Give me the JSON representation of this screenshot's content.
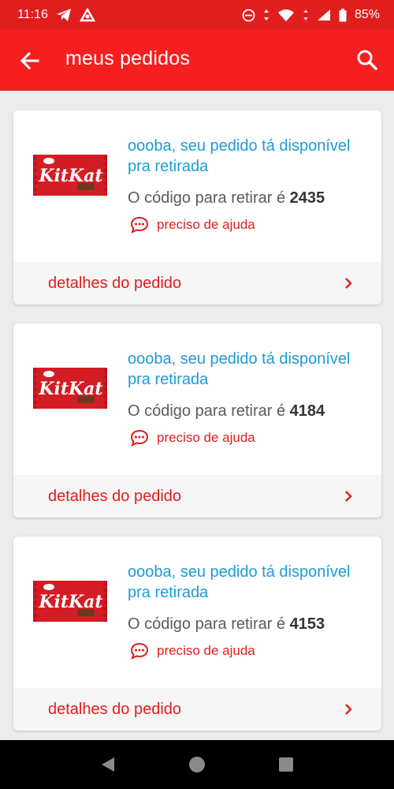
{
  "status_bar": {
    "time": "11:16",
    "battery": "85%"
  },
  "app_bar": {
    "title": "meus pedidos"
  },
  "orders": [
    {
      "product": "KitKat",
      "headline": "oooba, seu pedido tá disponível pra retirada",
      "code_label": "O código para retirar é",
      "code": "2435",
      "help_label": "preciso de ajuda",
      "details_label": "detalhes do pedido"
    },
    {
      "product": "KitKat",
      "headline": "oooba, seu pedido tá disponível pra retirada",
      "code_label": "O código para retirar é",
      "code": "4184",
      "help_label": "preciso de ajuda",
      "details_label": "detalhes do pedido"
    },
    {
      "product": "KitKat",
      "headline": "oooba, seu pedido tá disponível pra retirada",
      "code_label": "O código para retirar é",
      "code": "4153",
      "help_label": "preciso de ajuda",
      "details_label": "detalhes do pedido"
    }
  ],
  "colors": {
    "brand_red": "#f51f1f",
    "link_blue": "#1d9bd8",
    "accent_red": "#e21d1d"
  },
  "icons": {
    "back": "arrow-left-icon",
    "search": "search-icon",
    "help": "chat-bubble-icon",
    "details": "chevron-right-icon"
  }
}
